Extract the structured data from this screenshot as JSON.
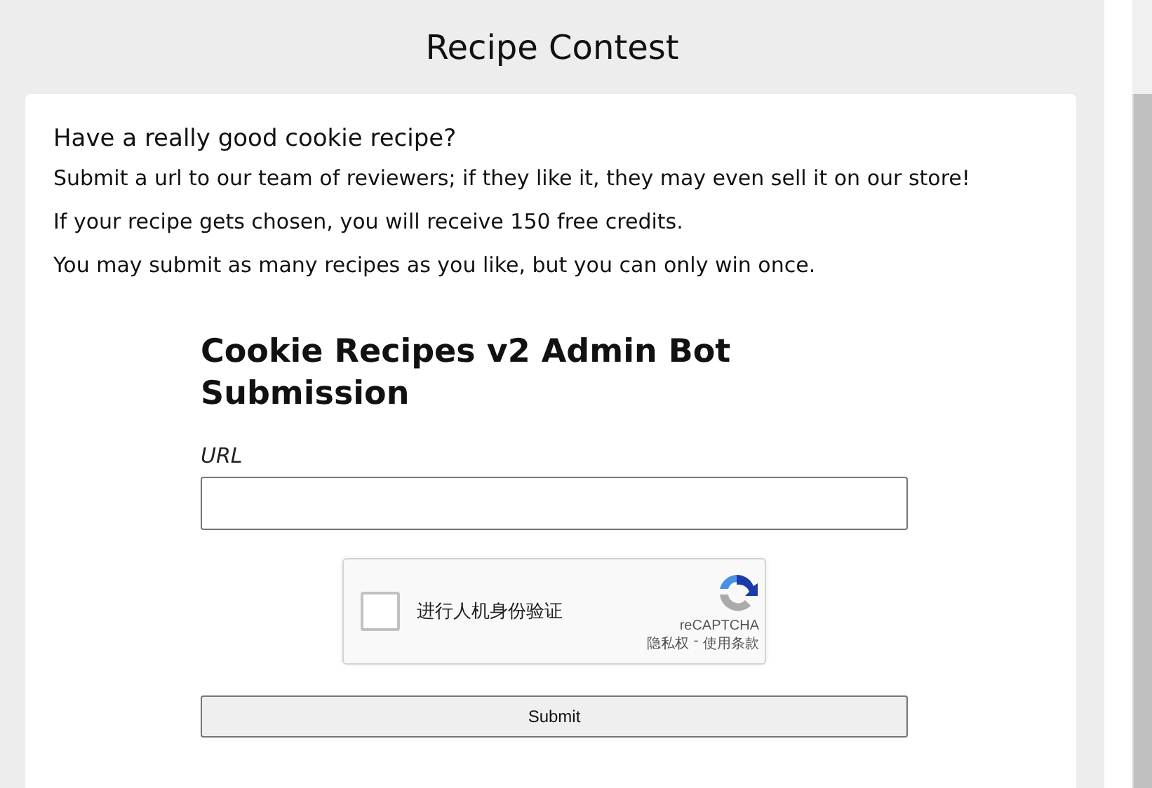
{
  "page_title": "Recipe Contest",
  "intro": {
    "heading": "Have a really good cookie recipe?",
    "paragraphs": [
      "Submit a url to our team of reviewers; if they like it, they may even sell it on our store!",
      "If your recipe gets chosen, you will receive 150 free credits.",
      "You may submit as many recipes as you like, but you can only win once."
    ]
  },
  "form": {
    "title": "Cookie Recipes v2 Admin Bot Submission",
    "url_label": "URL",
    "captcha": {
      "label": "进行人机身份验证",
      "checked": false,
      "brand": "reCAPTCHA",
      "privacy": "隐私权",
      "separator": " - ",
      "terms": "使用条款"
    },
    "submit": "Submit"
  }
}
